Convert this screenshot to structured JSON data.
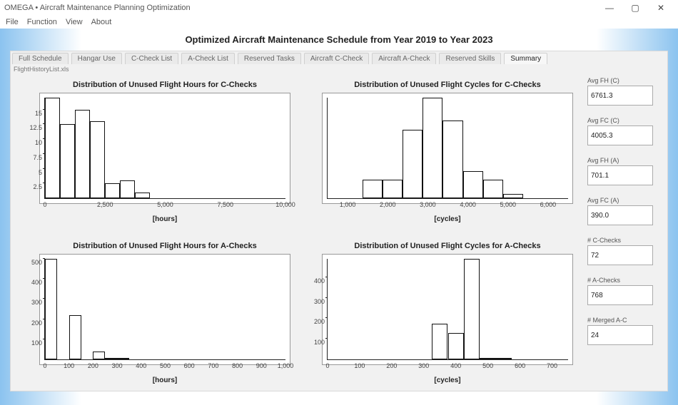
{
  "window": {
    "title": "OMEGA • Aircraft Maintenance Planning Optimization"
  },
  "menu": {
    "items": [
      "File",
      "Function",
      "View",
      "About"
    ]
  },
  "page_title": "Optimized Aircraft Maintenance Schedule from Year 2019 to Year 2023",
  "tabs": [
    {
      "label": "Full Schedule"
    },
    {
      "label": "Hangar Use"
    },
    {
      "label": "C-Check List"
    },
    {
      "label": "A-Check List"
    },
    {
      "label": "Reserved Tasks"
    },
    {
      "label": "Aircraft C-Check"
    },
    {
      "label": "Aircraft A-Check"
    },
    {
      "label": "Reserved Skills"
    },
    {
      "label": "Summary"
    }
  ],
  "subcaption": "FlightHistoryList.xls",
  "metrics": [
    {
      "label": "Avg FH (C)",
      "value": "6761.3"
    },
    {
      "label": "Avg FC (C)",
      "value": "4005.3"
    },
    {
      "label": "Avg FH (A)",
      "value": "701.1"
    },
    {
      "label": "Avg FC (A)",
      "value": "390.0"
    },
    {
      "label": "# C-Checks",
      "value": "72"
    },
    {
      "label": "# A-Checks",
      "value": "768"
    },
    {
      "label": "# Merged A-C",
      "value": "24"
    }
  ],
  "chart_data": [
    {
      "id": "fh_c",
      "type": "bar",
      "title": "Distribution of Unused Flight Hours for C-Checks",
      "xlabel": "[hours]",
      "categories": [
        0,
        625,
        1250,
        1875,
        2500,
        3125,
        3750
      ],
      "values": [
        17,
        12.5,
        15,
        13,
        2.5,
        3,
        1
      ],
      "ylim": [
        0,
        17
      ],
      "xlim": [
        0,
        10000
      ],
      "xticks": [
        0,
        2500,
        5000,
        7500,
        10000
      ],
      "yticks": [
        2.5,
        5,
        7.5,
        10,
        12.5,
        15
      ]
    },
    {
      "id": "fc_c",
      "type": "bar",
      "title": "Distribution of Unused Flight Cycles for C-Checks",
      "xlabel": "[cycles]",
      "categories": [
        1375,
        1875,
        2375,
        2875,
        3375,
        3875,
        4375,
        4875
      ],
      "values": [
        4,
        4,
        15,
        22,
        17,
        6,
        4,
        1
      ],
      "ylim": [
        0,
        22
      ],
      "xlim": [
        500,
        6500
      ],
      "xticks": [
        1000,
        2000,
        3000,
        4000,
        5000,
        6000
      ],
      "yticks": []
    },
    {
      "id": "fh_a",
      "type": "bar",
      "title": "Distribution of Unused Flight Hours for A-Checks",
      "xlabel": "[hours]",
      "categories": [
        0,
        50,
        100,
        150,
        200,
        250,
        300
      ],
      "values": [
        500,
        0,
        220,
        0,
        40,
        5,
        5
      ],
      "ylim": [
        0,
        500
      ],
      "xlim": [
        0,
        1000
      ],
      "xticks": [
        0,
        100,
        200,
        300,
        400,
        500,
        600,
        700,
        800,
        900,
        1000
      ],
      "yticks": [
        100,
        200,
        300,
        400,
        500
      ]
    },
    {
      "id": "fc_a",
      "type": "bar",
      "title": "Distribution of Unused Flight Cycles for A-Checks",
      "xlabel": "[cycles]",
      "categories": [
        325,
        375,
        425,
        475,
        525
      ],
      "values": [
        175,
        130,
        490,
        5,
        5
      ],
      "ylim": [
        0,
        490
      ],
      "xlim": [
        0,
        750
      ],
      "xticks": [
        0,
        100,
        200,
        300,
        400,
        500,
        600,
        700
      ],
      "yticks": [
        100,
        200,
        300,
        400
      ]
    }
  ]
}
